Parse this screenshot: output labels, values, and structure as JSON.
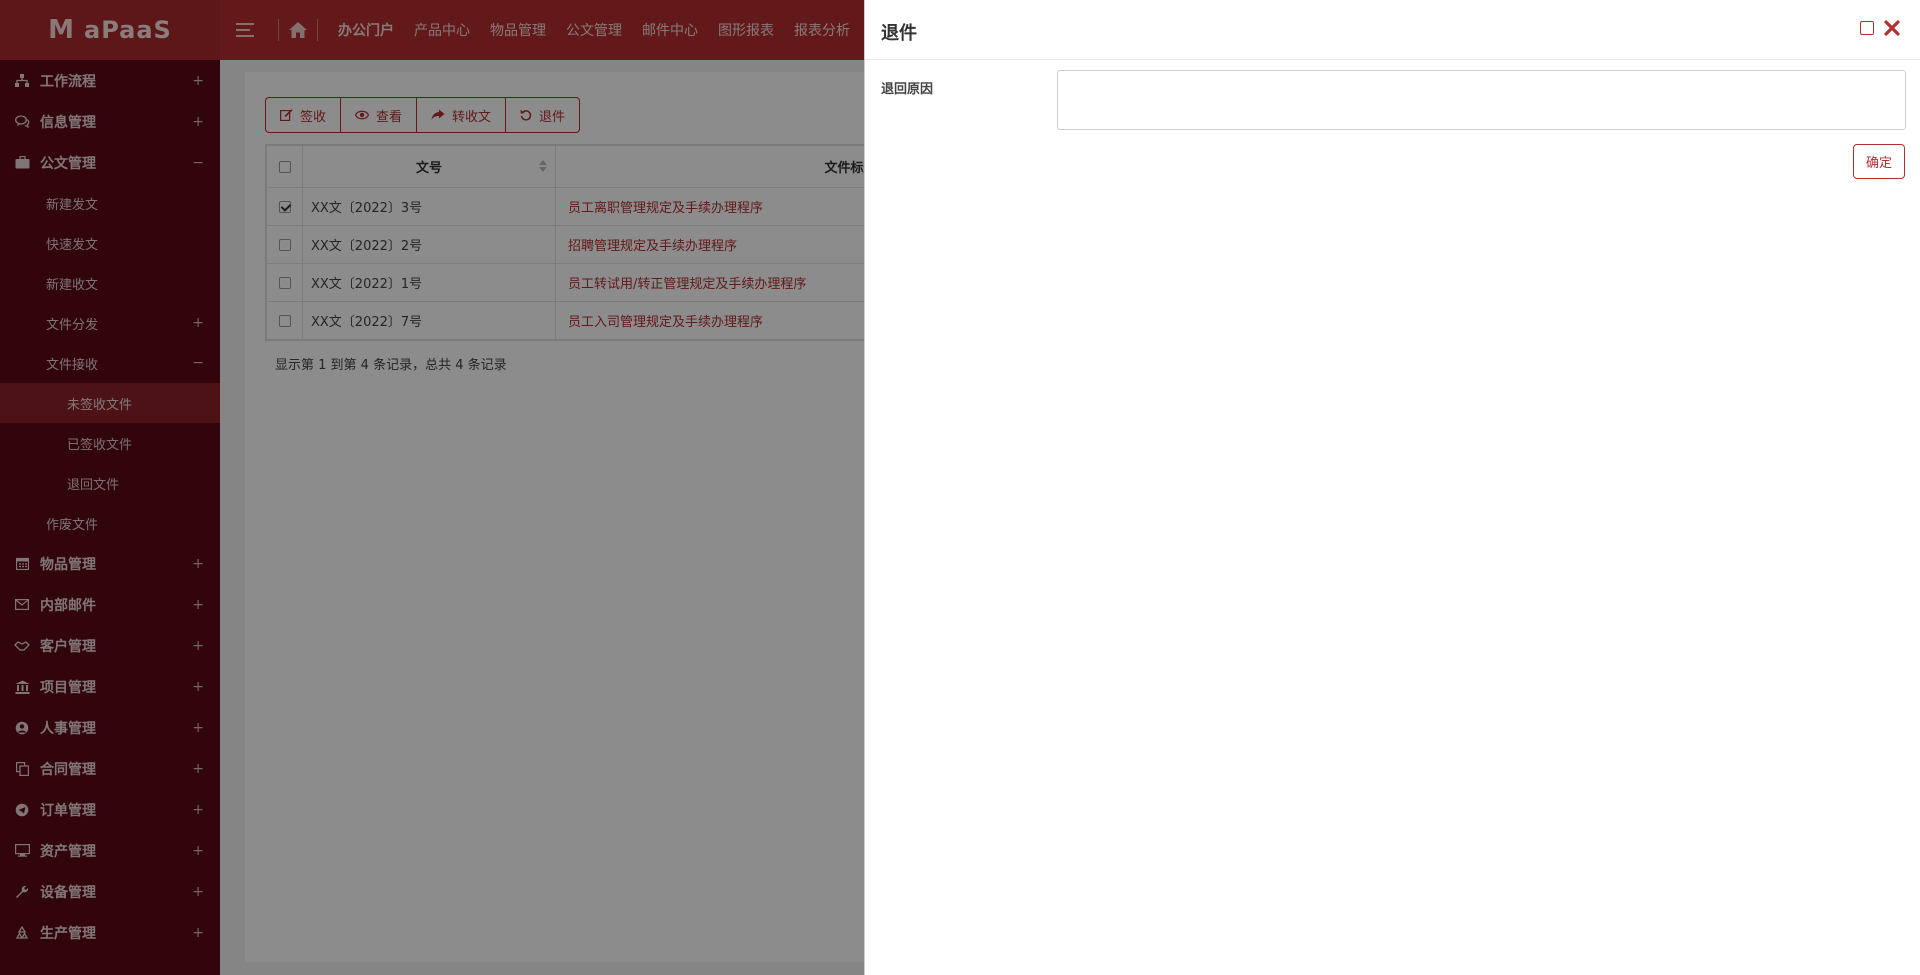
{
  "app": {
    "logo_mark": "M",
    "logo_text": "aPaaS"
  },
  "topnav": [
    "办公门户",
    "产品中心",
    "物品管理",
    "公文管理",
    "邮件中心",
    "图形报表",
    "报表分析"
  ],
  "sidebar": {
    "top_items": [
      {
        "label": "工作流程",
        "icon": "sitemap-icon",
        "toggle": "+"
      },
      {
        "label": "信息管理",
        "icon": "comments-icon",
        "toggle": "+"
      },
      {
        "label": "公文管理",
        "icon": "briefcase-icon",
        "toggle": "−"
      }
    ],
    "doc_sub": [
      {
        "label": "新建发文"
      },
      {
        "label": "快速发文"
      },
      {
        "label": "新建收文"
      },
      {
        "label": "文件分发",
        "toggle": "+"
      },
      {
        "label": "文件接收",
        "toggle": "−"
      }
    ],
    "receive_sub": [
      {
        "label": "未签收文件",
        "active": true
      },
      {
        "label": "已签收文件"
      },
      {
        "label": "退回文件"
      }
    ],
    "after_sub": {
      "label": "作废文件"
    },
    "bottom_items": [
      {
        "label": "物品管理",
        "icon": "calendar-icon",
        "toggle": "+"
      },
      {
        "label": "内部邮件",
        "icon": "envelope-icon",
        "toggle": "+"
      },
      {
        "label": "客户管理",
        "icon": "handshake-icon",
        "toggle": "+"
      },
      {
        "label": "项目管理",
        "icon": "bank-icon",
        "toggle": "+"
      },
      {
        "label": "人事管理",
        "icon": "user-circle-icon",
        "toggle": "+"
      },
      {
        "label": "合同管理",
        "icon": "copy-icon",
        "toggle": "+"
      },
      {
        "label": "订单管理",
        "icon": "telegram-icon",
        "toggle": "+"
      },
      {
        "label": "资产管理",
        "icon": "desktop-icon",
        "toggle": "+"
      },
      {
        "label": "设备管理",
        "icon": "wrench-icon",
        "toggle": "+"
      },
      {
        "label": "生产管理",
        "icon": "recycle-icon",
        "toggle": "+"
      }
    ]
  },
  "toolbar": {
    "sign": "签收",
    "view": "查看",
    "forward": "转收文",
    "return": "退件"
  },
  "table": {
    "headers": {
      "num": "文号",
      "title": "文件标题"
    },
    "rows": [
      {
        "num": "XX文〔2022〕3号",
        "title": "员工离职管理规定及手续办理程序",
        "checked": true
      },
      {
        "num": "XX文〔2022〕2号",
        "title": "招聘管理规定及手续办理程序",
        "checked": false
      },
      {
        "num": "XX文〔2022〕1号",
        "title": "员工转试用/转正管理规定及手续办理程序",
        "checked": false
      },
      {
        "num": "XX文〔2022〕7号",
        "title": "员工入司管理规定及手续办理程序",
        "checked": false
      }
    ],
    "pagination": "显示第 1 到第 4 条记录，总共 4 条记录"
  },
  "drawer": {
    "title": "退件",
    "reason_label": "退回原因",
    "reason_value": "",
    "confirm": "确定"
  },
  "colors": {
    "brand": "#b52f31",
    "sidebar": "#5a0a14",
    "active": "#8b2228"
  }
}
